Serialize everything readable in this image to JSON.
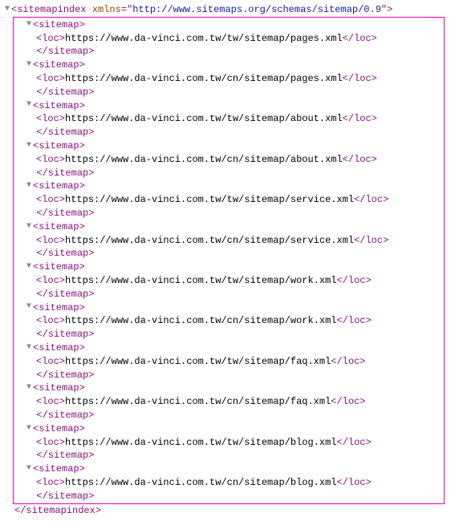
{
  "root": {
    "tag": "sitemapindex",
    "attrName": "xmlns",
    "attrValue": "http://www.sitemaps.org/schemas/sitemap/0.9"
  },
  "items": [
    {
      "url": "https://www.da-vinci.com.tw/tw/sitemap/pages.xml"
    },
    {
      "url": "https://www.da-vinci.com.tw/cn/sitemap/pages.xml"
    },
    {
      "url": "https://www.da-vinci.com.tw/tw/sitemap/about.xml"
    },
    {
      "url": "https://www.da-vinci.com.tw/cn/sitemap/about.xml"
    },
    {
      "url": "https://www.da-vinci.com.tw/tw/sitemap/service.xml"
    },
    {
      "url": "https://www.da-vinci.com.tw/cn/sitemap/service.xml"
    },
    {
      "url": "https://www.da-vinci.com.tw/tw/sitemap/work.xml"
    },
    {
      "url": "https://www.da-vinci.com.tw/cn/sitemap/work.xml"
    },
    {
      "url": "https://www.da-vinci.com.tw/tw/sitemap/faq.xml"
    },
    {
      "url": "https://www.da-vinci.com.tw/cn/sitemap/faq.xml"
    },
    {
      "url": "https://www.da-vinci.com.tw/tw/sitemap/blog.xml"
    },
    {
      "url": "https://www.da-vinci.com.tw/cn/sitemap/blog.xml"
    }
  ],
  "labels": {
    "sitemapOpen": "<sitemap>",
    "sitemapClose": "</sitemap>",
    "locOpen": "<loc>",
    "locClose": "</loc>",
    "rootClose": "</sitemapindex>",
    "toggle": "▼"
  }
}
